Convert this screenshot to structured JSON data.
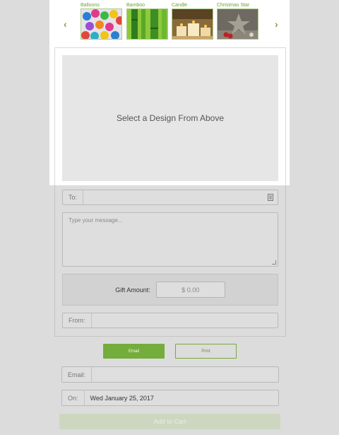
{
  "picker": {
    "prev_icon": "chevron-left-icon",
    "next_icon": "chevron-right-icon",
    "prev_glyph": "‹",
    "next_glyph": "›",
    "designs": [
      {
        "label": "Balloons"
      },
      {
        "label": "Bamboo"
      },
      {
        "label": "Candle"
      },
      {
        "label": "Christmas Star"
      }
    ],
    "preview_text": "Select a Design From Above"
  },
  "form": {
    "to_label": "To:",
    "to_value": "",
    "message_placeholder": "Type your message...",
    "amount_label": "Gift Amount:",
    "amount_value": "$ 0.00",
    "from_label": "From:",
    "from_value": ""
  },
  "delivery": {
    "email_button": "Email",
    "print_button": "Print",
    "email_label": "Email:",
    "email_value": "",
    "on_label": "On:",
    "on_value": "Wed January 25, 2017"
  },
  "cart_button": "Add to Cart",
  "colors": {
    "accent": "#74ad3b",
    "background": "#dcdcdc"
  }
}
